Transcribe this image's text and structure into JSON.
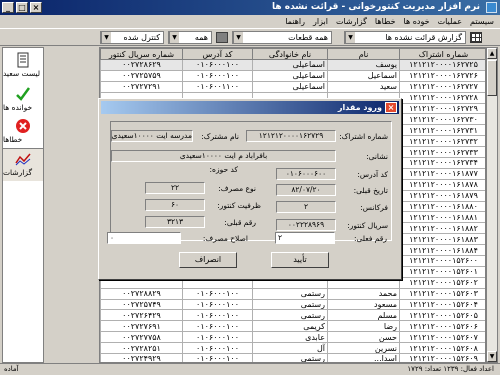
{
  "window": {
    "title": "نرم افزار مدیریت کنتورخوانی - قرائت نشده ها",
    "buttons": [
      "×",
      "□",
      "_"
    ]
  },
  "menu": [
    "سیستم",
    "عملیات",
    "خوده ها",
    "خطاها",
    "گزارشات",
    "ابزار",
    "راهنما"
  ],
  "toolbar": {
    "report_select": "گزارش قرائت نشده ها",
    "region_select": "همه قطعات",
    "route_select": "همه",
    "type_select": "کنترل شده"
  },
  "sidebar": [
    {
      "label": "لیست سعید",
      "icon": "document-list-icon"
    },
    {
      "label": "خوانده ها",
      "icon": "checkmark-icon"
    },
    {
      "label": "خطاها",
      "icon": "error-icon"
    },
    {
      "label": "گزارشات",
      "icon": "chart-icon"
    }
  ],
  "table": {
    "columns": [
      "شماره اشتراک",
      "نام",
      "نام خانوادگی",
      "کد آدرس",
      "شماره سریال کنتور"
    ],
    "rows": [
      [
        "۱۲۱۲۱۲۰۰۰۰۱۶۲۷۲۵",
        "یوسف",
        "اسماعیلی",
        "۰۱۰۶۰۰۰۱۰۰",
        "۰۰۲۷۲۸۶۲۹"
      ],
      [
        "۱۲۱۲۱۲۰۰۰۰۱۶۲۷۲۶",
        "اسماعیل",
        "اسماعیلی",
        "۰۱۰۶۰۰۰۱۰۰",
        "۰۰۲۷۲۵۷۵۹"
      ],
      [
        "۱۲۱۲۱۲۰۰۰۰۱۶۲۷۲۷",
        "سعید",
        "اسماعیلی",
        "۰۱۰۶۰۰۱۱۰۰",
        "۰۰۲۷۲۷۲۹۱"
      ],
      [
        "۱۲۱۲۱۲۰۰۰۰۱۶۲۷۲۸",
        "",
        "",
        "",
        ""
      ],
      [
        "۱۲۱۲۱۲۰۰۰۰۱۶۲۷۲۹",
        "",
        "",
        "",
        ""
      ],
      [
        "۱۲۱۲۱۲۰۰۰۰۱۶۲۷۳۰",
        "",
        "",
        "",
        ""
      ],
      [
        "۱۲۱۲۱۲۰۰۰۰۱۶۲۷۳۱",
        "",
        "",
        "",
        ""
      ],
      [
        "۱۲۱۲۱۲۰۰۰۰۱۶۲۷۳۲",
        "",
        "",
        "",
        ""
      ],
      [
        "۱۲۱۲۱۲۰۰۰۰۱۶۲۷۳۳",
        "",
        "",
        "",
        ""
      ],
      [
        "۱۲۱۲۱۲۰۰۰۰۱۶۲۷۳۴",
        "",
        "",
        "",
        ""
      ],
      [
        "۱۲۱۲۱۲۰۰۰۰۱۶۱۸۷۷",
        "",
        "",
        "",
        ""
      ],
      [
        "۱۲۱۲۱۲۰۰۰۰۱۶۱۸۷۸",
        "",
        "",
        "",
        ""
      ],
      [
        "۱۲۱۲۱۲۰۰۰۰۱۶۱۸۷۹",
        "",
        "",
        "",
        ""
      ],
      [
        "۱۲۱۲۱۲۰۰۰۰۱۶۱۸۸۰",
        "",
        "",
        "",
        ""
      ],
      [
        "۱۲۱۲۱۲۰۰۰۰۱۶۱۸۸۱",
        "",
        "",
        "",
        ""
      ],
      [
        "۱۲۱۲۱۲۰۰۰۰۱۶۱۸۸۲",
        "",
        "",
        "",
        ""
      ],
      [
        "۱۲۱۲۱۲۰۰۰۰۱۶۱۸۸۳",
        "",
        "",
        "",
        ""
      ],
      [
        "۱۲۱۲۱۲۰۰۰۰۱۶۱۸۸۴",
        "",
        "",
        "",
        ""
      ],
      [
        "۱۲۱۲۱۲۰۰۰۰۱۵۲۶۰۰",
        "",
        "",
        "",
        ""
      ],
      [
        "۱۲۱۲۱۲۰۰۰۰۱۵۲۶۰۱",
        "",
        "",
        "",
        ""
      ],
      [
        "۱۲۱۲۱۲۰۰۰۰۱۵۲۶۰۲",
        "",
        "",
        "",
        ""
      ],
      [
        "۱۲۱۲۱۲۰۰۰۰۱۵۲۶۰۳",
        "محمد",
        "رستمی",
        "۰۱۰۶۰۰۰۱۰۰",
        "۰۰۲۷۲۸۸۲۹"
      ],
      [
        "۱۲۱۲۱۲۰۰۰۰۱۵۲۶۰۴",
        "مسعود",
        "رستمی",
        "۰۱۰۶۰۰۰۱۰۰",
        "۰۰۲۷۲۵۷۴۹"
      ],
      [
        "۱۲۱۲۱۲۰۰۰۰۱۵۲۶۰۵",
        "مسلم",
        "رستمی",
        "۰۱۰۶۰۰۰۱۰۰",
        "۰۰۲۷۲۶۴۲۹"
      ],
      [
        "۱۲۱۲۱۲۰۰۰۰۱۵۲۶۰۶",
        "رضا",
        "کریمی",
        "۰۱۰۶۰۰۰۱۰۰",
        "۰۰۲۷۲۷۶۹۱"
      ],
      [
        "۱۲۱۲۱۲۰۰۰۰۱۵۲۶۰۷",
        "حسن",
        "عابدی",
        "۰۱۰۶۰۰۰۱۰۰",
        "۰۰۲۷۲۷۷۵۸"
      ],
      [
        "۱۲۱۲۱۲۰۰۰۰۱۵۲۶۰۸",
        "نسرین",
        "آل",
        "۰۱۰۶۰۰۰۱۰۰",
        "۰۰۲۷۲۸۲۵۱"
      ],
      [
        "۱۲۱۲۱۲۰۰۰۰۱۵۲۶۰۹",
        "اسدا...",
        "رستمی",
        "۰۱۰۶۰۰۰۱۰۰",
        "۰۰۲۷۲۴۹۲۹"
      ]
    ]
  },
  "status": {
    "left": "آماده",
    "right": "اعداد فعال: ۱۲۳۹  تعداد: ۱۷۲۹"
  },
  "dialog": {
    "title": "ورود مقدار",
    "fields": {
      "subscription_label": "شماره اشتراک:",
      "subscription_value": "۱۲۱۲۱۲۰۰۰۰۱۶۲۷۲۹",
      "name_label": "نام مشترک:",
      "name_value": "مدرسه ایت ۱۰۰۰۰سعیدی",
      "address_label": "نشانی:",
      "address_value": "بافراباد م ایت ۱۰۰۰۰سعیدی",
      "area_code_label": "کد حوزه:",
      "address_code_label": "کد آدرس:",
      "address_code_value": "۰۱۰۶۰۰۰۶۰۰",
      "prev_date_label": "تاریخ قبلی:",
      "prev_date_value": "۸۲/۰۷/۲۰",
      "usage_type_label": "نوع مصرف:",
      "usage_type_value": "۲۲",
      "reading_cycle_label": "فرکانس:",
      "reading_cycle_value": "۲",
      "capacity_label": "ظرفیت کنتور:",
      "capacity_value": "۶۰",
      "serial_label": "سریال کنتور:",
      "serial_value": "۰۰۲۲۲۸۹۶۹",
      "prev_reading_label": "رقم قبلی:",
      "prev_reading_value": "۳۲۱۳",
      "current_reading_label": "رقم فعلی:",
      "current_reading_value": "۲",
      "consumption_fix_label": "اصلاح مصرف:",
      "consumption_fix_value": "۰"
    },
    "confirm_label": "تأیید",
    "cancel_label": "انصراف"
  }
}
